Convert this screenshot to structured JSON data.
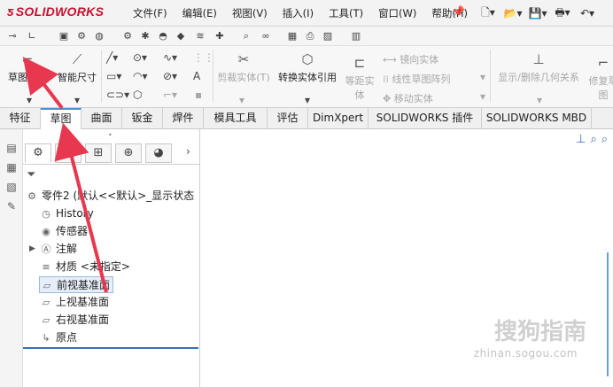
{
  "app": {
    "logo_text": "SOLIDWORKS",
    "menu": [
      "文件(F)",
      "编辑(E)",
      "视图(V)",
      "插入(I)",
      "工具(T)",
      "窗口(W)",
      "帮助(H)"
    ]
  },
  "ribbon": {
    "sketch_label": "草图绘制",
    "smart_dim_label": "智能尺寸",
    "trim_label": "剪裁实体(T)",
    "convert_label": "转换实体引用",
    "offset_label_1": "等距实",
    "offset_label_2": "体",
    "mirror_label": "镜向实体",
    "linear_label": "线性草图阵列",
    "move_label": "移动实体",
    "relations_label": "显示/删除几何关系",
    "repair_label_1": "修复草",
    "repair_label_2": "图"
  },
  "tabs": [
    "特征",
    "草图",
    "曲面",
    "钣金",
    "焊件",
    "模具工具",
    "评估",
    "DimXpert",
    "SOLIDWORKS 插件",
    "SOLIDWORKS MBD"
  ],
  "tree": {
    "root": "零件2 (默认<<默认>_显示状态",
    "items": [
      "History",
      "传感器",
      "注解",
      "材质 <未指定>",
      "前视基准面",
      "上视基准面",
      "右视基准面",
      "原点"
    ]
  },
  "watermark": {
    "main": "搜狗指南",
    "url": "zhinan.sogou.com"
  },
  "colors": {
    "accent": "#4a90d9",
    "logo": "#c8102e",
    "arrow": "#e8384f"
  }
}
